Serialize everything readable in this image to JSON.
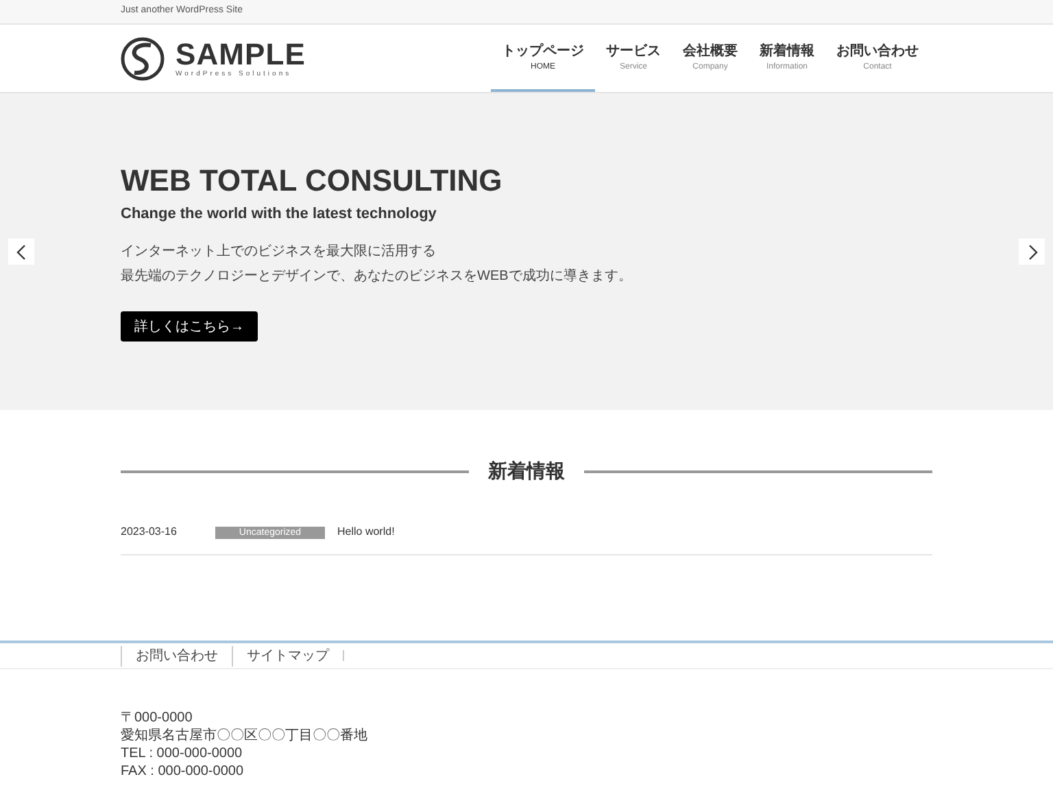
{
  "top_bar": {
    "tagline": "Just another WordPress Site"
  },
  "header": {
    "logo": {
      "name": "SAMPLE",
      "subtitle": "WordPress Solutions"
    },
    "nav": [
      {
        "label": "トップページ",
        "sub": "HOME",
        "selected": true
      },
      {
        "label": "サービス",
        "sub": "Service",
        "selected": false
      },
      {
        "label": "会社概要",
        "sub": "Company",
        "selected": false
      },
      {
        "label": "新着情報",
        "sub": "Information",
        "selected": false
      },
      {
        "label": "お問い合わせ",
        "sub": "Contact",
        "selected": false
      }
    ]
  },
  "hero": {
    "title": "WEB TOTAL CONSULTING",
    "subtitle": "Change the world with the latest technology",
    "lines": [
      "インターネット上でのビジネスを最大限に活用する",
      "最先端のテクノロジーとデザインで、あなたのビジネスをWEBで成功に導きます。"
    ],
    "button": "詳しくはこちら→"
  },
  "news": {
    "heading": "新着情報",
    "items": [
      {
        "date": "2023-03-16",
        "category": "Uncategorized",
        "title": "Hello world!"
      }
    ]
  },
  "footer": {
    "nav": [
      "お問い合わせ",
      "サイトマップ"
    ],
    "address": [
      "〒000-0000",
      "愛知県名古屋市〇〇区〇〇丁目〇〇番地",
      "TEL : 000-000-0000",
      "FAX : 000-000-0000"
    ]
  }
}
